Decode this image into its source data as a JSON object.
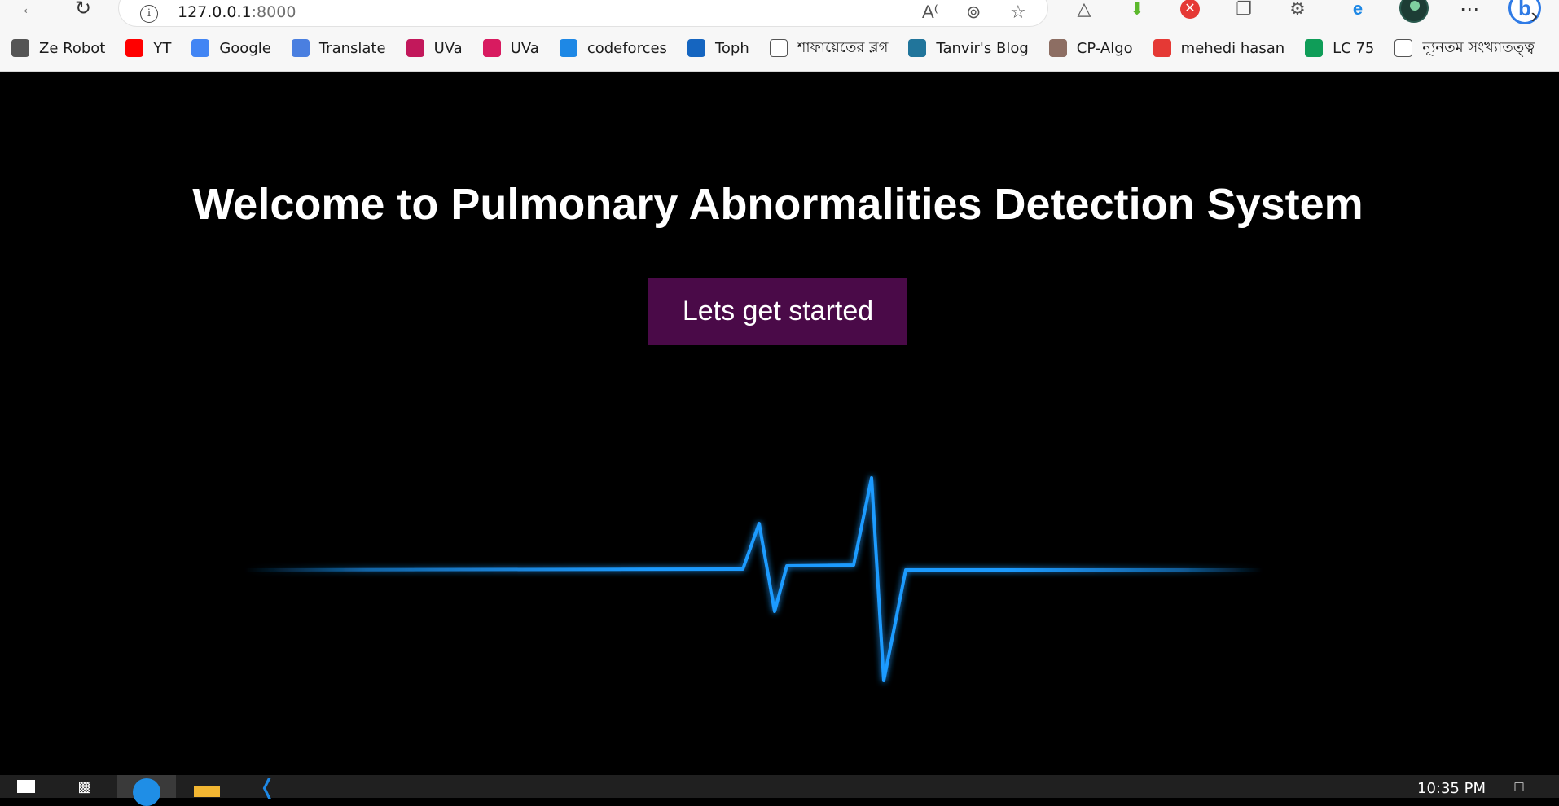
{
  "browser": {
    "url_host": "127.0.0.1",
    "url_port": ":8000",
    "bookmarks": [
      {
        "label": "Ze Robot",
        "icon": "robot-icon",
        "color": "#555555"
      },
      {
        "label": "YT",
        "icon": "youtube-icon",
        "color": "#ff0000"
      },
      {
        "label": "Google",
        "icon": "google-icon",
        "color": "#4285f4"
      },
      {
        "label": "Translate",
        "icon": "translate-icon",
        "color": "#4a7fe0"
      },
      {
        "label": "UVa",
        "icon": "uva-icon",
        "color": "#c2185b"
      },
      {
        "label": "UVa",
        "icon": "uva-icon",
        "color": "#d81b60"
      },
      {
        "label": "codeforces",
        "icon": "codeforces-icon",
        "color": "#1e88e5"
      },
      {
        "label": "Toph",
        "icon": "toph-icon",
        "color": "#1565c0"
      },
      {
        "label": "শাফায়েতের ব্লগ",
        "icon": "page-icon",
        "color": "#ffffff"
      },
      {
        "label": "Tanvir's Blog",
        "icon": "wordpress-icon",
        "color": "#21759b"
      },
      {
        "label": "CP-Algo",
        "icon": "cp-algo-icon",
        "color": "#8d6e63"
      },
      {
        "label": "mehedi hasan",
        "icon": "mehedi-icon",
        "color": "#e53935"
      },
      {
        "label": "LC 75",
        "icon": "sheets-icon",
        "color": "#0f9d58"
      },
      {
        "label": "ন্যূনতম সংখ্যাতত্ত্ব",
        "icon": "link-icon",
        "color": "#9e9e9e"
      }
    ]
  },
  "page": {
    "headline": "Welcome to Pulmonary Abnormalities Detection System",
    "cta_label": "Lets get started",
    "ecg_color": "#1e9bff"
  },
  "taskbar": {
    "clock": "10:35 PM"
  }
}
